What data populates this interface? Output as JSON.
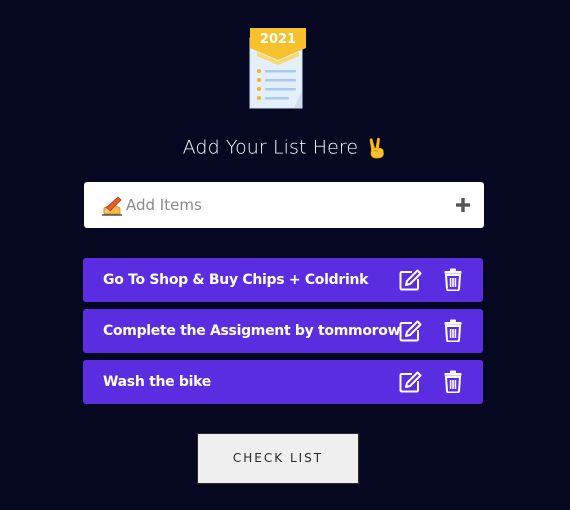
{
  "logo": {
    "icon": "checklist-2021-icon",
    "year": "2021"
  },
  "heading": {
    "title": "Add Your List Here",
    "emoji_icon": "victory-hand-icon"
  },
  "add_item": {
    "placeholder": "Add Items",
    "value": "",
    "leading_icon": "writing-hand-icon",
    "action_icon": "plus-icon"
  },
  "items": [
    {
      "label": "Go To Shop & Buy Chips + Coldrink",
      "edit_icon": "edit-icon",
      "delete_icon": "trash-icon"
    },
    {
      "label": "Complete the Assigment by tommorow",
      "edit_icon": "edit-icon",
      "delete_icon": "trash-icon"
    },
    {
      "label": "Wash the bike",
      "edit_icon": "edit-icon",
      "delete_icon": "trash-icon"
    }
  ],
  "check_list_button": {
    "label": "CHECK LIST"
  },
  "colors": {
    "background": "#060822",
    "item_background": "#5a2ee0",
    "input_background": "#ffffff",
    "button_background": "#efefef",
    "logo_banner": "#f6c12a"
  }
}
